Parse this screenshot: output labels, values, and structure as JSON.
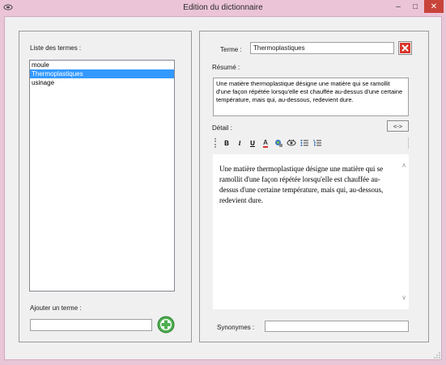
{
  "window": {
    "title": "Edition du dictionnaire",
    "minimize_glyph": "–",
    "maximize_glyph": "□",
    "close_glyph": "✕"
  },
  "left_panel": {
    "terms_label": "Liste des termes :",
    "terms": [
      {
        "label": "moule",
        "selected": false
      },
      {
        "label": "Thermoplastiques",
        "selected": true
      },
      {
        "label": "usinage",
        "selected": false
      }
    ],
    "add_label": "Ajouter un terme :",
    "add_input_value": "",
    "add_icon": "plus-circle-icon"
  },
  "right_panel": {
    "term_label": "Terme :",
    "term_value": "Thermoplastiques",
    "delete_icon": "delete-x-icon",
    "summary_label": "Résumé :",
    "summary_text": "Une matière thermoplastique désigne une matière qui se ramollit d'une façon répétée lorsqu'elle est chauffée au-dessus d'une certaine température, mais qui, au-dessous, redevient dure.",
    "detail_label": "Détail :",
    "toggle_label": "<->",
    "toolbar": {
      "bold": "B",
      "italic": "I",
      "underline": "U",
      "font_color": "A",
      "icons": [
        "grip-icon",
        "bold-icon",
        "italic-icon",
        "underline-icon",
        "font-color-icon",
        "image-icon",
        "link-icon",
        "bullet-list-icon",
        "numbered-list-icon"
      ]
    },
    "detail_text": "Une matière thermoplastique désigne une matière qui se ramollit d'une façon répétée lorsqu'elle est chauffée au-dessus d'une certaine température, mais qui, au-dessous, redevient dure.",
    "synonyms_label": "Synonymes :",
    "synonyms_value": ""
  },
  "colors": {
    "selection": "#3399ff",
    "title_bar": "#ebc4d7",
    "delete_red": "#d9342b",
    "add_green": "#4caf50"
  }
}
